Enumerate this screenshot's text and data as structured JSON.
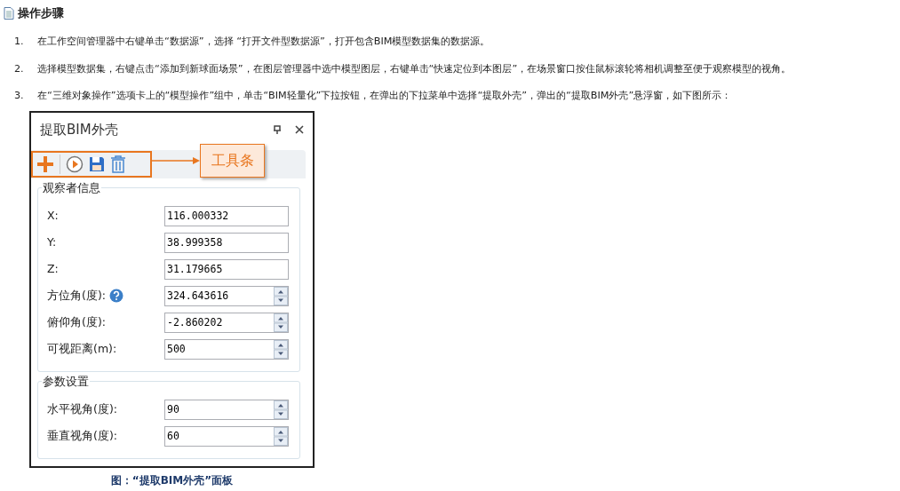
{
  "heading": {
    "title": "操作步骤"
  },
  "steps": [
    {
      "number": "1.",
      "text": "在工作空间管理器中右键单击“数据源”，选择 “打开文件型数据源”，打开包含BIM模型数据集的数据源。"
    },
    {
      "number": "2.",
      "text": "选择模型数据集，右键点击“添加到新球面场景”，在图层管理器中选中模型图层，右键单击“快速定位到本图层”，在场景窗口按住鼠标滚轮将相机调整至便于观察模型的视角。"
    },
    {
      "number": "3.",
      "text": "在“三维对象操作”选项卡上的“模型操作”组中，单击“BIM轻量化”下拉按钮，在弹出的下拉菜单中选择“提取外壳”，弹出的“提取BIM外壳”悬浮窗，如下图所示："
    }
  ],
  "panel": {
    "title": "提取BIM外壳",
    "callout": "工具条",
    "groups": [
      {
        "title": "观察者信息",
        "fields": [
          {
            "label": "X:",
            "value": "116.000332",
            "kind": "text",
            "help": false
          },
          {
            "label": "Y:",
            "value": "38.999358",
            "kind": "text",
            "help": false
          },
          {
            "label": "Z:",
            "value": "31.179665",
            "kind": "text",
            "help": false
          },
          {
            "label": "方位角(度):",
            "value": "324.643616",
            "kind": "spin",
            "help": true
          },
          {
            "label": "俯仰角(度):",
            "value": "-2.860202",
            "kind": "spin",
            "help": false
          },
          {
            "label": "可视距离(m):",
            "value": "500",
            "kind": "spin",
            "help": false
          }
        ]
      },
      {
        "title": "参数设置",
        "fields": [
          {
            "label": "水平视角(度):",
            "value": "90",
            "kind": "spin",
            "help": false
          },
          {
            "label": "垂直视角(度):",
            "value": "60",
            "kind": "spin",
            "help": false
          }
        ]
      }
    ]
  },
  "caption": "图：“提取BIM外壳”面板"
}
